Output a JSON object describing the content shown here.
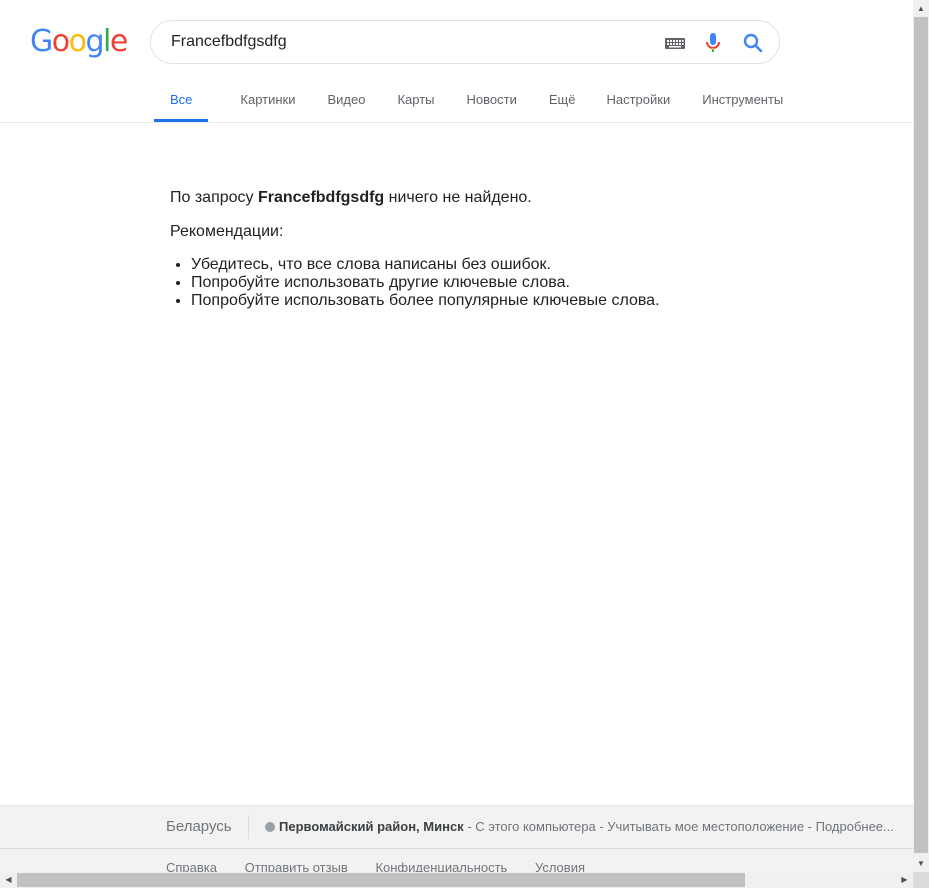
{
  "logo": {
    "letters": [
      "G",
      "o",
      "o",
      "g",
      "l",
      "e"
    ],
    "colors": [
      "#4285f4",
      "#ea4335",
      "#fbbc05",
      "#4285f4",
      "#34a853",
      "#ea4335"
    ]
  },
  "search": {
    "value": "Francefbdfgsdfg",
    "keyboard_icon": "keyboard-icon",
    "mic_icon": "microphone-icon",
    "search_icon": "search-icon"
  },
  "tabs": [
    {
      "label": "Все",
      "active": true
    },
    {
      "label": "Картинки"
    },
    {
      "label": "Видео"
    },
    {
      "label": "Карты"
    },
    {
      "label": "Новости"
    },
    {
      "label": "Ещё"
    },
    {
      "label": "Настройки"
    },
    {
      "label": "Инструменты"
    }
  ],
  "results": {
    "no_results_prefix": "По запросу ",
    "query": "Francefbdfgsdfg",
    "no_results_suffix": " ничего не найдено.",
    "recommendations_title": "Рекомендации:",
    "recommendations": [
      "Убедитесь, что все слова написаны без ошибок.",
      "Попробуйте использовать другие ключевые слова.",
      "Попробуйте использовать более популярные ключевые слова."
    ]
  },
  "footer": {
    "country": "Беларусь",
    "location_name": "Первомайский район, Минск",
    "sep1": " - ",
    "from_computer": "С этого компьютера",
    "sep2": " - ",
    "use_location": "Учитывать мое местоположение",
    "sep3": " - ",
    "more": "Подробнее...",
    "links": [
      "Справка",
      "Отправить отзыв",
      "Конфиденциальность",
      "Условия"
    ]
  },
  "colors": {
    "accent": "#1a73e8",
    "text": "#222222",
    "muted": "#70757a"
  }
}
